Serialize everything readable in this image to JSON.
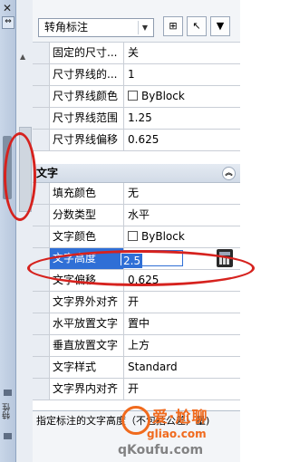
{
  "toolbar": {
    "dropdown_value": "转角标注",
    "buttons": [
      "select-objects",
      "quick-select",
      "toggle-pickadd"
    ]
  },
  "strip": {
    "vertical_label": "特性"
  },
  "top_rows": [
    {
      "name": "固定的尺寸...",
      "value": "关"
    },
    {
      "name": "尺寸界线的...",
      "value": "1"
    },
    {
      "name": "尺寸界线颜色",
      "value": "ByBlock",
      "swatch": true
    },
    {
      "name": "尺寸界线范围",
      "value": "1.25"
    },
    {
      "name": "尺寸界线偏移",
      "value": "0.625"
    }
  ],
  "section": {
    "title": "文字"
  },
  "text_rows": [
    {
      "name": "填充颜色",
      "value": "无"
    },
    {
      "name": "分数类型",
      "value": "水平"
    },
    {
      "name": "文字颜色",
      "value": "ByBlock",
      "swatch": true
    },
    {
      "name": "文字高度",
      "value": "2.5",
      "selected": true
    },
    {
      "name": "文字偏移",
      "value": "0.625"
    },
    {
      "name": "文字界外对齐",
      "value": "开"
    },
    {
      "name": "水平放置文字",
      "value": "置中"
    },
    {
      "name": "垂直放置文字",
      "value": "上方"
    },
    {
      "name": "文字样式",
      "value": "Standard"
    },
    {
      "name": "文字界内对齐",
      "value": "开"
    }
  ],
  "description": "指定标注的文字高度（不包括公差）量)",
  "watermark": {
    "brand": "爱·尬聊",
    "site": "gliao.com",
    "sub": "qKoufu.com"
  },
  "colors": {
    "selection": "#2f6fd6",
    "annotation": "#d6221e",
    "watermark": "#f06a1d"
  }
}
